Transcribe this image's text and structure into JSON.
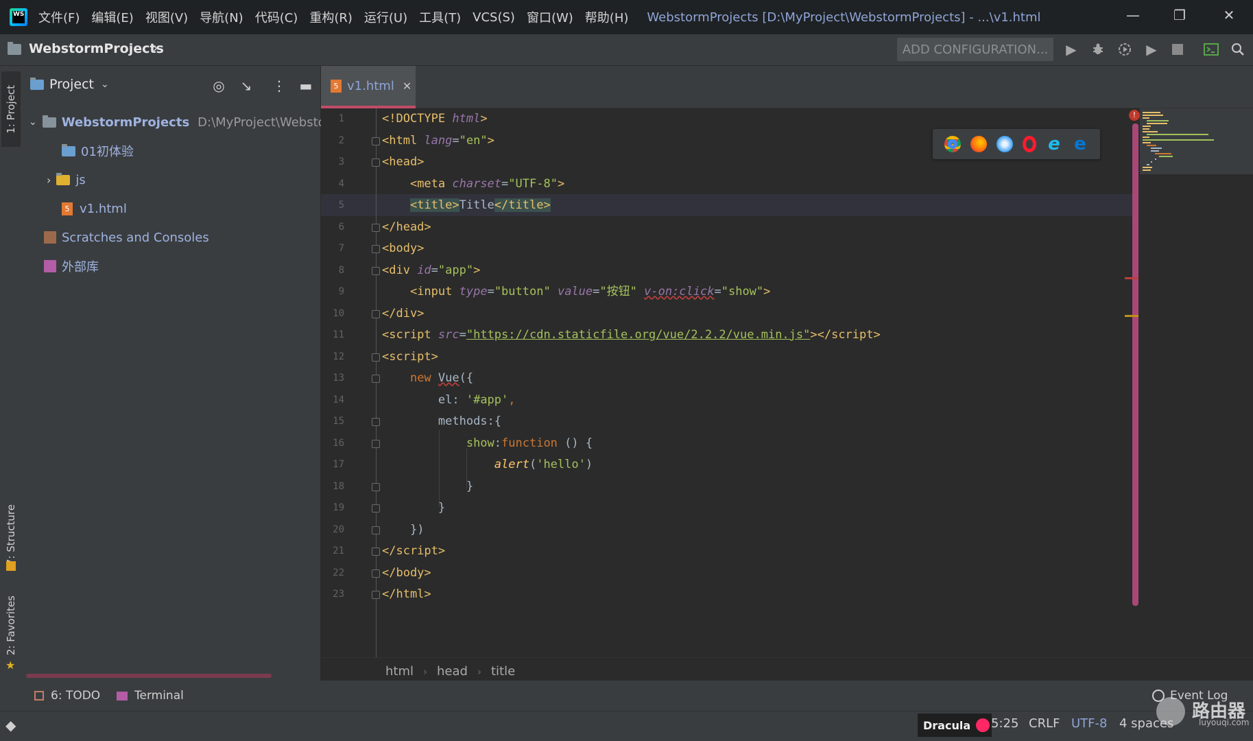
{
  "app": {
    "logo_text": "WS",
    "menu": [
      "文件(F)",
      "编辑(E)",
      "视图(V)",
      "导航(N)",
      "代码(C)",
      "重构(R)",
      "运行(U)",
      "工具(T)",
      "VCS(S)",
      "窗口(W)",
      "帮助(H)"
    ],
    "window_title": "WebstormProjects [D:\\MyProject\\WebstormProjects] - ...\\v1.html"
  },
  "navbar": {
    "project": "WebstormProjects",
    "add_config": "ADD CONFIGURATION..."
  },
  "side_tabs": {
    "project": "1: Project",
    "structure": "7: Structure",
    "favorites": "2: Favorites"
  },
  "project_panel": {
    "title": "Project",
    "tree": [
      {
        "label": "WebstormProjects",
        "path": "D:\\MyProject\\Webstorm"
      },
      {
        "label": "01初体验"
      },
      {
        "label": "js"
      },
      {
        "label": "v1.html"
      },
      {
        "label": "Scratches and Consoles"
      },
      {
        "label": "外部库"
      }
    ]
  },
  "editor": {
    "tab": "v1.html",
    "line_numbers": [
      "1",
      "2",
      "3",
      "4",
      "5",
      "6",
      "7",
      "8",
      "9",
      "10",
      "11",
      "12",
      "13",
      "14",
      "15",
      "16",
      "17",
      "18",
      "19",
      "20",
      "21",
      "22",
      "23"
    ],
    "breadcrumb": [
      "html",
      "head",
      "title"
    ]
  },
  "bottom_tools": {
    "todo": "6: TODO",
    "terminal": "Terminal",
    "event_log": "Event Log"
  },
  "status": {
    "theme": "Dracula",
    "position": "5:25",
    "line_sep": "CRLF",
    "encoding": "UTF-8",
    "indent": "4 spaces"
  },
  "watermark": {
    "text": "路由器",
    "url": "luyouqi.com"
  },
  "colors": {
    "accent_pink": "#c04c6a",
    "tag": "#e8bf6a",
    "attr": "#9876aa",
    "string": "#a5c25c",
    "keyword": "#cc7832"
  }
}
